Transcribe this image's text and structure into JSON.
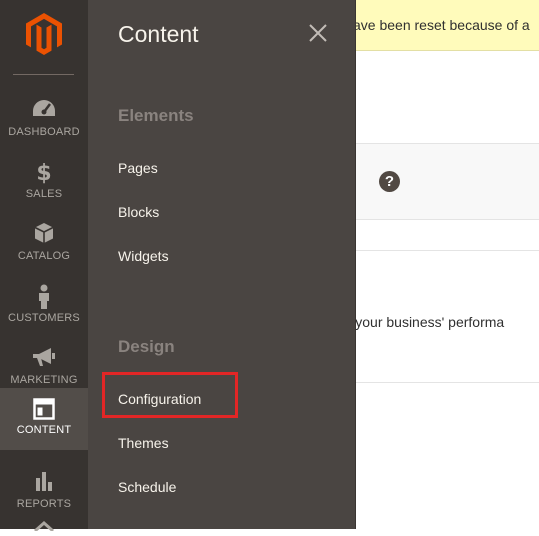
{
  "sidebar": {
    "items": [
      {
        "label": "DASHBOARD",
        "icon": "dashboard-icon"
      },
      {
        "label": "SALES",
        "icon": "dollar-icon"
      },
      {
        "label": "CATALOG",
        "icon": "cube-icon"
      },
      {
        "label": "CUSTOMERS",
        "icon": "person-icon"
      },
      {
        "label": "MARKETING",
        "icon": "megaphone-icon"
      },
      {
        "label": "CONTENT",
        "icon": "layout-icon"
      },
      {
        "label": "REPORTS",
        "icon": "bar-chart-icon"
      }
    ],
    "active": "CONTENT"
  },
  "submenu": {
    "title": "Content",
    "sections": [
      {
        "label": "Elements",
        "items": [
          "Pages",
          "Blocks",
          "Widgets"
        ]
      },
      {
        "label": "Design",
        "items": [
          "Configuration",
          "Themes",
          "Schedule"
        ]
      }
    ],
    "highlighted_item": "Configuration"
  },
  "page": {
    "notice": "ave been reset because of a",
    "partial_text": "d of your business' performa",
    "help_glyph": "?"
  },
  "colors": {
    "sidebar_bg": "#373330",
    "submenu_bg": "#4a4542",
    "brand_orange": "#eb5202",
    "highlight_border": "#e22626",
    "notice_bg": "#fffbbb"
  }
}
